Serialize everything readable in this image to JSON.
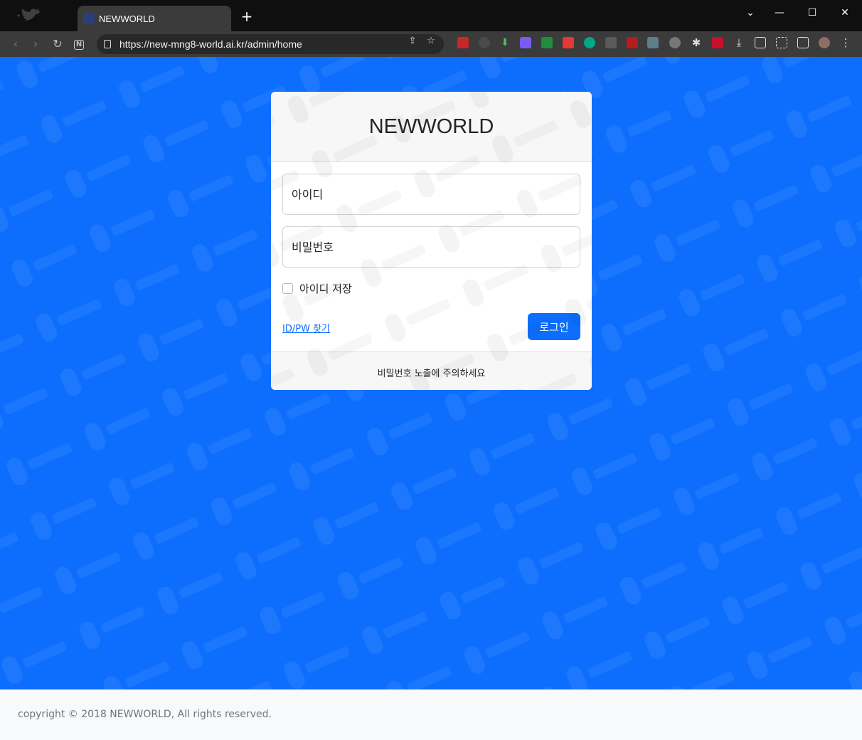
{
  "browser": {
    "tab_title": "NEWWORLD",
    "new_tab_label": "+",
    "url": "https://new-mng8-world.ai.kr/admin/home",
    "controls": {
      "minimize": "—",
      "maximize": "☐",
      "close": "✕",
      "tab_list": "⌄"
    }
  },
  "login": {
    "site_title": "NEWWORLD",
    "id_placeholder": "아이디",
    "password_placeholder": "비밀번호",
    "remember_label": "아이디 저장",
    "remember_checked": false,
    "find_link": "ID/PW 찾기",
    "login_button": "로그인",
    "notice": "비밀번호 노출에 주의하세요"
  },
  "footer": {
    "copyright": "copyright © 2018 NEWWORLD, All rights reserved."
  },
  "colors": {
    "page_background": "#0d6efd",
    "button": "#0d6efd",
    "link": "#0d6efd"
  },
  "icons": [
    "back-icon",
    "forward-icon",
    "reload-icon",
    "notion-icon",
    "lock-icon",
    "share-icon",
    "bookmark-star-icon",
    "extensions-icon",
    "download-icon",
    "sidebar-icon",
    "more-icon"
  ]
}
